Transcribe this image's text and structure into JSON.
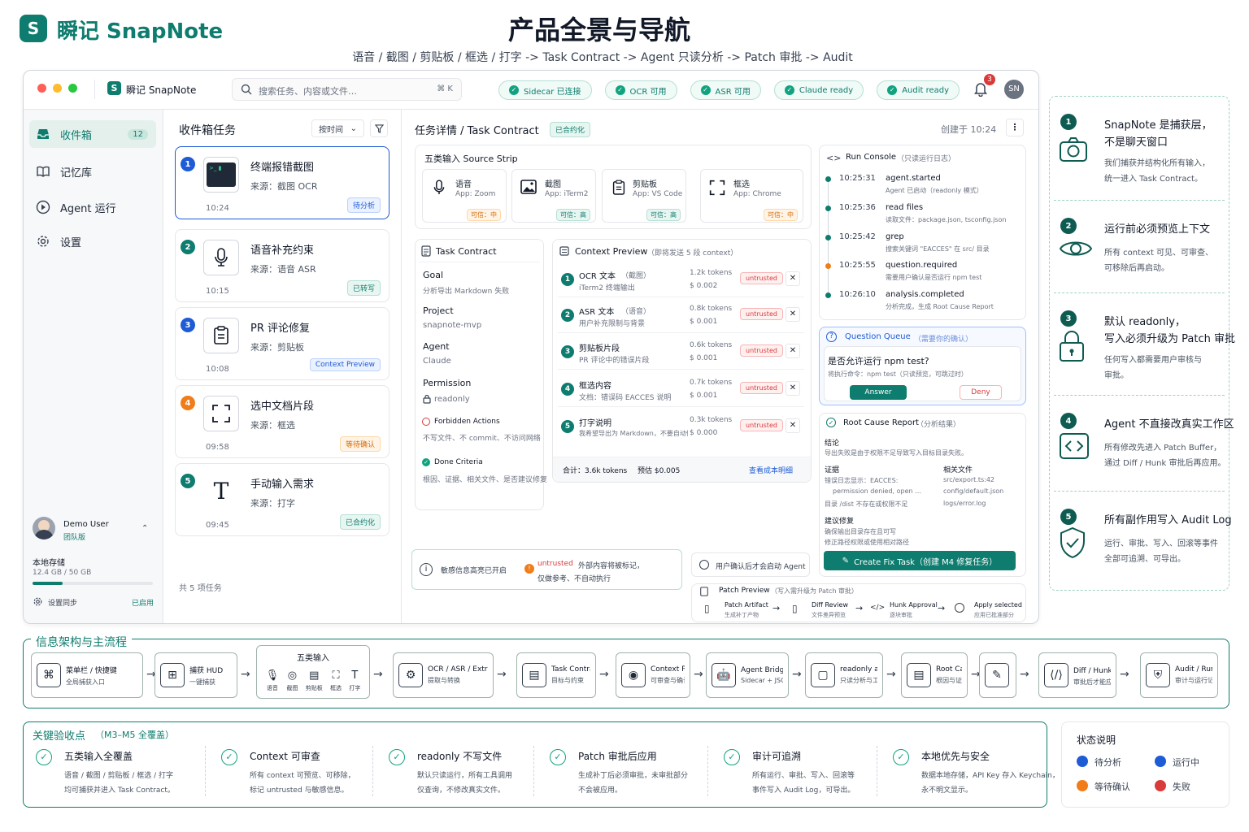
{
  "brand": {
    "name": "瞬记 SnapNote",
    "app_short": "瞬记 SnapNote"
  },
  "header": {
    "title": "产品全景与导航",
    "subtitle": "语音 / 截图 / 剪贴板 / 框选 / 打字 -> Task Contract -> Agent 只读分析 -> Patch 审批 -> Audit"
  },
  "topbar": {
    "search_placeholder": "搜索任务、内容或文件…",
    "shortcut": "⌘ K",
    "status": [
      "Sidecar 已连接",
      "OCR 可用",
      "ASR 可用",
      "Claude ready",
      "Audit ready"
    ],
    "notif_count": "3",
    "avatar": "SN"
  },
  "sidebar": {
    "items": [
      {
        "label": "收件箱",
        "count": "12"
      },
      {
        "label": "记忆库"
      },
      {
        "label": "Agent 运行"
      },
      {
        "label": "设置"
      }
    ],
    "user": {
      "name": "Demo User",
      "team": "团队版"
    },
    "storage": {
      "label": "本地存储",
      "value": "12.4 GB / 50 GB",
      "fraction": 0.248
    },
    "sync": {
      "label": "设置同步",
      "status": "已启用"
    }
  },
  "inbox": {
    "title": "收件箱任务",
    "sort": "按时间",
    "footer": "共 5 项任务",
    "tasks": [
      {
        "n": "1",
        "title": "终端报错截图",
        "source": "来源：截图 OCR",
        "time": "10:24",
        "badge": "待分析"
      },
      {
        "n": "2",
        "title": "语音补充约束",
        "source": "来源：语音 ASR",
        "time": "10:15",
        "badge": "已转写"
      },
      {
        "n": "3",
        "title": "PR 评论修复",
        "source": "来源：剪贴板",
        "time": "10:08",
        "badge": "Context Preview"
      },
      {
        "n": "4",
        "title": "选中文档片段",
        "source": "来源：框选",
        "time": "09:58",
        "badge": "等待确认"
      },
      {
        "n": "5",
        "title": "手动输入需求",
        "source": "来源：打字",
        "time": "09:45",
        "badge": "已合约化"
      }
    ]
  },
  "detail": {
    "title": "任务详情 / Task Contract",
    "badge": "已合约化",
    "created": "创建于 10:24",
    "strip_title": "五类输入 Source Strip",
    "sources": [
      {
        "name": "语音",
        "app": "App: Zoom",
        "conf": "可信：中"
      },
      {
        "name": "截图",
        "app": "App: iTerm2",
        "conf": "可信：高"
      },
      {
        "name": "剪贴板",
        "app": "App: VS Code",
        "conf": "可信：高"
      },
      {
        "name": "框选",
        "app": "App: Chrome",
        "conf": "可信：中"
      }
    ],
    "contract": {
      "title": "Task Contract",
      "goal_l": "Goal",
      "goal": "分析导出 Markdown 失败",
      "project_l": "Project",
      "project": "snapnote-mvp",
      "agent_l": "Agent",
      "agent": "Claude",
      "perm_l": "Permission",
      "perm": "readonly",
      "forbid_l": "Forbidden Actions",
      "forbid": "不写文件、不 commit、不访问网络",
      "done_l": "Done Criteria",
      "done": "根因、证据、相关文件、是否建议修复"
    },
    "context": {
      "title": "Context Preview",
      "sub": "（即将发送 5 段 context）",
      "rows": [
        {
          "n": "1",
          "t": "OCR 文本",
          "tk": "（截图）",
          "d": "iTerm2 终端输出",
          "tokens": "1.2k tokens",
          "cost": "$ 0.002",
          "tag": "untrusted"
        },
        {
          "n": "2",
          "t": "ASR 文本",
          "tk": "（语音）",
          "d": "用户补充限制与背景",
          "tokens": "0.8k tokens",
          "cost": "$ 0.001",
          "tag": "untrusted"
        },
        {
          "n": "3",
          "t": "剪贴板片段",
          "tk": "",
          "d": "PR 评论中的错误片段",
          "tokens": "0.6k tokens",
          "cost": "$ 0.001",
          "tag": "untrusted"
        },
        {
          "n": "4",
          "t": "框选内容",
          "tk": "",
          "d": "文档：错误码 EACCES 说明",
          "tokens": "0.7k tokens",
          "cost": "$ 0.001",
          "tag": "untrusted"
        },
        {
          "n": "5",
          "t": "打字说明",
          "tk": "",
          "d": "我希望导出为 Markdown，不要自动修改代码",
          "tokens": "0.3k tokens",
          "cost": "$ 0.000",
          "tag": "untrusted"
        }
      ],
      "total": "合计：3.6k tokens",
      "est": "预估 $0.005",
      "link": "查看成本明细"
    },
    "notice": {
      "a": "敏感信息高亮已开启",
      "tag": "untrusted",
      "b": "外部内容将被标记，",
      "c": "仅做参考、不自动执行"
    }
  },
  "console": {
    "title": "Run Console",
    "sub": "（只读运行日志）",
    "logs": [
      {
        "t": "10:25:31",
        "e": "agent.started",
        "d": "Agent 已启动（readonly 模式）",
        "c": "#0e7c6e"
      },
      {
        "t": "10:25:36",
        "e": "read files",
        "d": "读取文件：package.json, tsconfig.json",
        "c": "#0e7c6e"
      },
      {
        "t": "10:25:42",
        "e": "grep",
        "d": "搜索关键词 \"EACCES\" 在 src/ 目录",
        "c": "#0e7c6e"
      },
      {
        "t": "10:25:55",
        "e": "question.required",
        "d": "需要用户确认是否运行 npm test",
        "c": "#f07d1a"
      },
      {
        "t": "10:26:10",
        "e": "analysis.completed",
        "d": "分析完成，生成 Root Cause Report",
        "c": "#0e7c6e"
      }
    ]
  },
  "question": {
    "title": "Question Queue",
    "sub": "（需要你的确认）",
    "q": "是否允许运行 npm test?",
    "cmd": "将执行命令：npm test（只读预览，可跳过时）",
    "answer": "Answer",
    "deny": "Deny"
  },
  "report": {
    "title": "Root Cause Report",
    "sub": "（分析结果）",
    "concl_l": "结论",
    "concl": "导出失败是由于权限不足导致写入目标目录失败。",
    "ev_l": "证据",
    "ev": [
      "错误日志显示：EACCES:",
      "permission denied, open …",
      "目录 /dist 不存在或权限不足"
    ],
    "files_l": "相关文件",
    "files": [
      "src/export.ts:42",
      "config/default.json",
      "logs/error.log"
    ],
    "sugg_l": "建议修复",
    "sugg": [
      "确保输出目录存在且可写",
      "修正路径权限或使用相对路径"
    ],
    "btn": "Create Fix Task（创建 M4 修复任务）"
  },
  "confirm": "用户确认后才会启动 Agent",
  "patch": {
    "title": "Patch Preview",
    "sub": "（写入需升级为 Patch 审批）",
    "steps": [
      {
        "a": "Patch Artifact",
        "b": "生成补丁产物"
      },
      {
        "a": "Diff Review",
        "b": "文件差异预览"
      },
      {
        "a": "Hunk Approval",
        "b": "逐块审批"
      },
      {
        "a": "Apply selected",
        "b": "应用已批准部分"
      }
    ]
  },
  "flow": {
    "title": "信息架构与主流程",
    "nodes": [
      {
        "a": "菜单栏 / 快捷键",
        "b": "全局捕获入口"
      },
      {
        "a": "捕获 HUD",
        "b": "一键捕获"
      },
      {
        "a": "五类输入",
        "items": [
          "语音",
          "截图",
          "剪贴板",
          "框选",
          "打字"
        ]
      },
      {
        "a": "OCR / ASR / Extract",
        "b": "提取与转换"
      },
      {
        "a": "Task Contract",
        "b": "目标与约束"
      },
      {
        "a": "Context Preview",
        "b": "可审查与确认"
      },
      {
        "a": "Agent Bridge",
        "b": "Sidecar + JSON-RPC"
      },
      {
        "a": "readonly analysis",
        "b": "只读分析与工具调用"
      },
      {
        "a": "Root Cause Report",
        "b": "根因与证据"
      },
      {
        "a": "",
        "b": ""
      },
      {
        "a": "Diff / Hunk 审批",
        "b": "审批后才能应用"
      },
      {
        "a": "Audit / Runs",
        "b": "审计与运行记录"
      }
    ]
  },
  "accept": {
    "title": "关键验收点",
    "sub": "（M3–M5 全覆盖）",
    "items": [
      {
        "t": "五类输入全覆盖",
        "d1": "语音 / 截图 / 剪贴板 / 框选 / 打字",
        "d2": "均可捕获并进入 Task Contract。"
      },
      {
        "t": "Context 可审查",
        "d1": "所有 context 可预览、可移除，",
        "d2": "标记 untrusted 与敏感信息。"
      },
      {
        "t": "readonly 不写文件",
        "d1": "默认只读运行，所有工具调用",
        "d2": "仅查询，不修改真实文件。"
      },
      {
        "t": "Patch 审批后应用",
        "d1": "生成补丁后必须审批，未审批部分",
        "d2": "不会被应用。"
      },
      {
        "t": "审计可追溯",
        "d1": "所有运行、审批、写入、回滚等",
        "d2": "事件写入 Audit Log，可导出。"
      },
      {
        "t": "本地优先与安全",
        "d1": "数据本地存储，API Key 存入 Keychain，",
        "d2": "永不明文显示。"
      }
    ]
  },
  "legend": {
    "title": "状态说明",
    "items": [
      {
        "l": "待分析",
        "c": "#1e5bd6"
      },
      {
        "l": "运行中",
        "c": "#1e5bd6"
      },
      {
        "l": "等待确认",
        "c": "#f07d1a"
      },
      {
        "l": "失败",
        "c": "#d93a3a"
      }
    ]
  },
  "steps": [
    {
      "n": "1",
      "t1": "SnapNote 是捕获层，",
      "t2": "不是聊天窗口",
      "d1": "我们捕获并结构化所有输入，",
      "d2": "统一进入 Task Contract。",
      "icon": "camera-icon"
    },
    {
      "n": "2",
      "t1": "运行前必须预览上下文",
      "t2": "",
      "d1": "所有 context 可见、可审查、",
      "d2": "可移除后再启动。",
      "icon": "eye-icon"
    },
    {
      "n": "3",
      "t1": "默认 readonly，",
      "t2": "写入必须升级为 Patch 审批",
      "d1": "任何写入都需要用户审核与",
      "d2": "审批。",
      "icon": "lock-icon"
    },
    {
      "n": "4",
      "t1": "Agent 不直接改真实工作区",
      "t2": "",
      "d1": "所有修改先进入 Patch Buffer，",
      "d2": "通过 Diff / Hunk 审批后再应用。",
      "icon": "code-icon"
    },
    {
      "n": "5",
      "t1": "所有副作用写入 Audit Log",
      "t2": "",
      "d1": "运行、审批、写入、回滚等事件",
      "d2": "全部可追溯、可导出。",
      "icon": "shield-check-icon"
    }
  ]
}
